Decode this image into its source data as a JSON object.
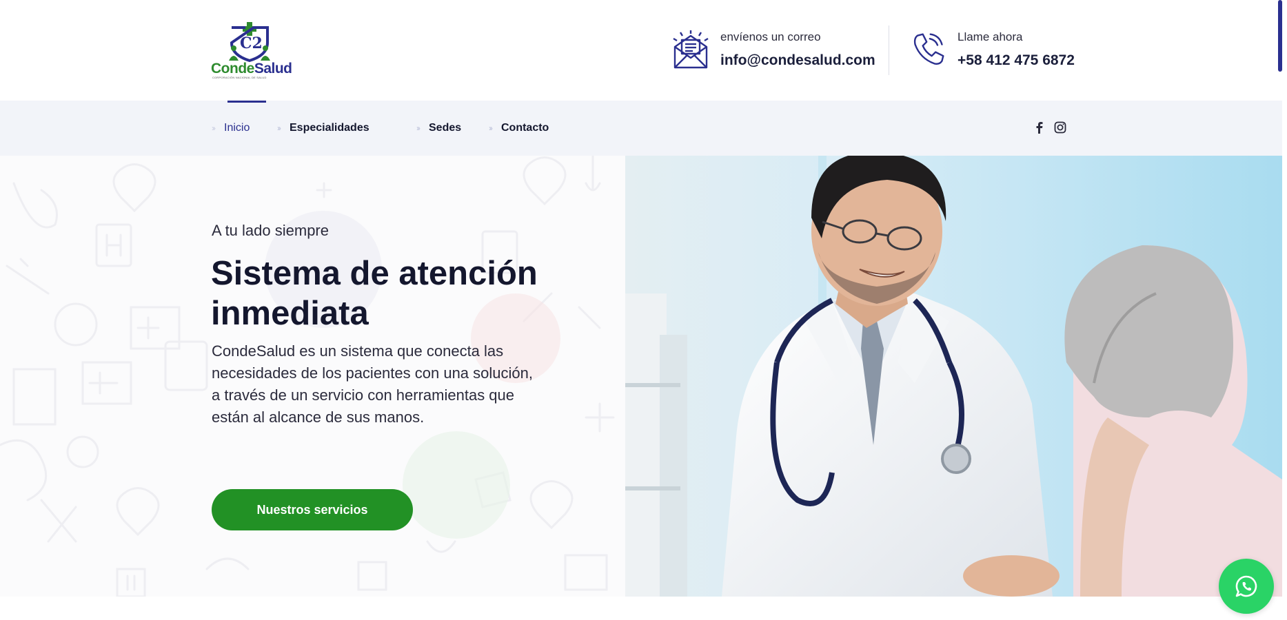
{
  "brand": {
    "name_part1": "Conde",
    "name_part2": "Salud",
    "tagline": "CORPORACIÓN NACIONAL DE SALUD",
    "colors": {
      "green": "#229125",
      "navy": "#2a2f8f",
      "dark": "#14172e",
      "whatsapp": "#2ad366"
    }
  },
  "header": {
    "email": {
      "icon": "mail-envelope-icon",
      "label": "envíenos un correo",
      "value": "info@condesalud.com"
    },
    "phone": {
      "icon": "phone-icon",
      "label": "Llame ahora",
      "value": "+58 412 475 6872"
    }
  },
  "nav": {
    "items": [
      {
        "label": "Inicio",
        "active": true
      },
      {
        "label": "Especialidades",
        "active": false
      },
      {
        "label": "Sedes",
        "active": false
      },
      {
        "label": "Contacto",
        "active": false
      }
    ],
    "separator": "››",
    "social": [
      "facebook-icon",
      "instagram-icon"
    ]
  },
  "hero": {
    "eyebrow": "A tu lado siempre",
    "title": "Sistema de atención inmediata",
    "description": "CondeSalud es un sistema que conecta las necesidades de los pacientes con una solución, a través de un servicio con herramientas que están al alcance de sus manos.",
    "cta_label": "Nuestros servicios",
    "image": "doctor-with-patient-photo"
  },
  "floating": {
    "icon": "whatsapp-icon"
  }
}
